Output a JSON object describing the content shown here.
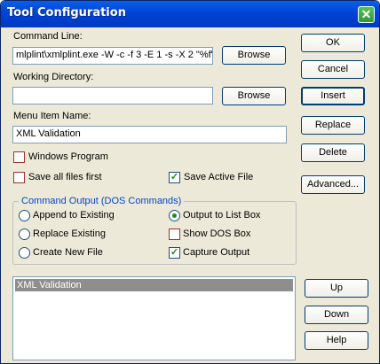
{
  "window": {
    "title": "Tool Configuration",
    "close_glyph": "✕"
  },
  "command_line": {
    "label": "Command Line:",
    "value": "mlplint\\xmlplint.exe -W -c -f 3 -E 1 -s -X 2 \"%f\"",
    "browse_label": "Browse"
  },
  "working_dir": {
    "label": "Working Directory:",
    "value": "",
    "browse_label": "Browse"
  },
  "menu_item": {
    "label": "Menu Item Name:",
    "value": "XML Validation"
  },
  "checkboxes": {
    "windows_program": {
      "label": "Windows Program",
      "checked": false
    },
    "save_all": {
      "label": "Save all files first",
      "checked": false
    },
    "save_active": {
      "label": "Save Active File",
      "checked": true
    },
    "show_dos": {
      "label": "Show DOS Box",
      "checked": false
    },
    "capture_output": {
      "label": "Capture Output",
      "checked": true
    }
  },
  "command_output": {
    "title": "Command Output (DOS Commands)",
    "append": {
      "label": "Append to Existing",
      "selected": false
    },
    "replace": {
      "label": "Replace Existing",
      "selected": false
    },
    "create_new": {
      "label": "Create New File",
      "selected": false
    },
    "output_list": {
      "label": "Output to List Box",
      "selected": true
    }
  },
  "buttons": {
    "ok": "OK",
    "cancel": "Cancel",
    "insert": "Insert",
    "replace": "Replace",
    "delete": "Delete",
    "advanced": "Advanced...",
    "up": "Up",
    "down": "Down",
    "help": "Help"
  },
  "tools_list": {
    "items": [
      "XML Validation"
    ],
    "selected_index": 0
  },
  "colors": {
    "title_bar": "#0043d6",
    "group_title": "#0046d5",
    "check_mark": "#1f8a1f",
    "selection": "#8e8e8e"
  }
}
